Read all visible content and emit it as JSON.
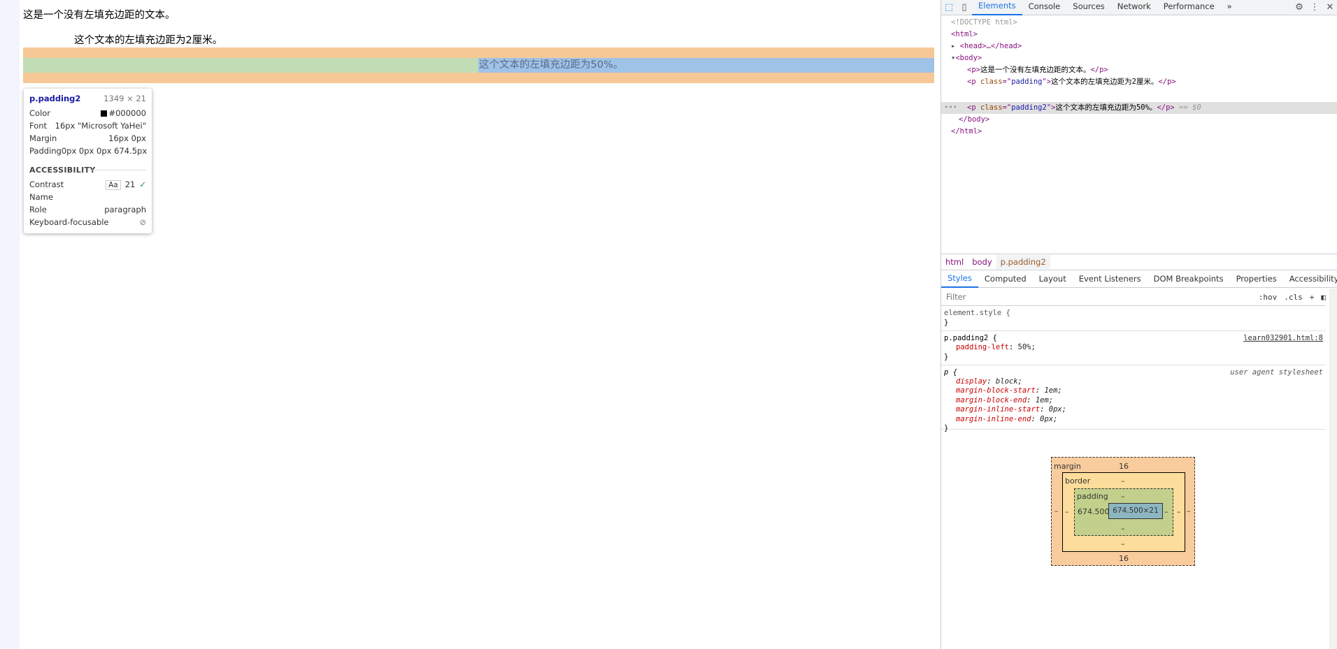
{
  "page": {
    "line1": "这是一个没有左填充边距的文本。",
    "line2": "这个文本的左填充边距为2厘米。",
    "line3": "这个文本的左填充边距为50%。"
  },
  "tooltip": {
    "selector": "p.padding2",
    "size": "1349 × 21",
    "color_label": "Color",
    "color_value": "#000000",
    "font_label": "Font",
    "font_value": "16px \"Microsoft YaHei\"",
    "margin_label": "Margin",
    "margin_value": "16px 0px",
    "padding_label": "Padding",
    "padding_value": "0px 0px 0px 674.5px",
    "accessibility_label": "ACCESSIBILITY",
    "contrast_label": "Contrast",
    "contrast_aa": "Aa",
    "contrast_value": "21",
    "name_label": "Name",
    "role_label": "Role",
    "role_value": "paragraph",
    "focusable_label": "Keyboard-focusable"
  },
  "devtools": {
    "tabs": [
      "Elements",
      "Console",
      "Sources",
      "Network",
      "Performance"
    ],
    "more": "»",
    "dom": {
      "doctype": "<!DOCTYPE html>",
      "html_open": "<html>",
      "head": "<head>…</head>",
      "body_open": "<body>",
      "p1_text": "这是一个没有左填充边距的文本。",
      "p2_class": "padding",
      "p2_text": "这个文本的左填充边距为2厘米。",
      "p3_class": "padding2",
      "p3_text": "这个文本的左填充边距为50%。",
      "p3_suffix": "== $0",
      "body_close": "</body>",
      "html_close": "</html>"
    },
    "breadcrumbs": [
      "html",
      "body",
      "p.padding2"
    ],
    "subtabs": [
      "Styles",
      "Computed",
      "Layout",
      "Event Listeners",
      "DOM Breakpoints",
      "Properties",
      "Accessibility"
    ],
    "filter_placeholder": "Filter",
    "filter_hov": ":hov",
    "filter_cls": ".cls",
    "styles": {
      "element_style": "element.style {",
      "close": "}",
      "rule1_selector": "p.padding2 {",
      "rule1_source": "learn032901.html:8",
      "rule1_prop": "padding-left",
      "rule1_val": "50%;",
      "rule2_selector": "p {",
      "rule2_source": "user agent stylesheet",
      "ua_props": [
        {
          "prop": "display",
          "val": "block;"
        },
        {
          "prop": "margin-block-start",
          "val": "1em;"
        },
        {
          "prop": "margin-block-end",
          "val": "1em;"
        },
        {
          "prop": "margin-inline-start",
          "val": "0px;"
        },
        {
          "prop": "margin-inline-end",
          "val": "0px;"
        }
      ]
    },
    "boxmodel": {
      "margin_label": "margin",
      "margin_top": "16",
      "margin_bottom": "16",
      "margin_left": "–",
      "margin_right": "–",
      "border_label": "border",
      "border_top": "–",
      "border_bottom": "–",
      "border_left": "–",
      "border_right": "–",
      "padding_label": "padding",
      "padding_top": "–",
      "padding_bottom": "–",
      "padding_left": "674.500",
      "padding_right": "–",
      "content": "674.500×21"
    }
  }
}
